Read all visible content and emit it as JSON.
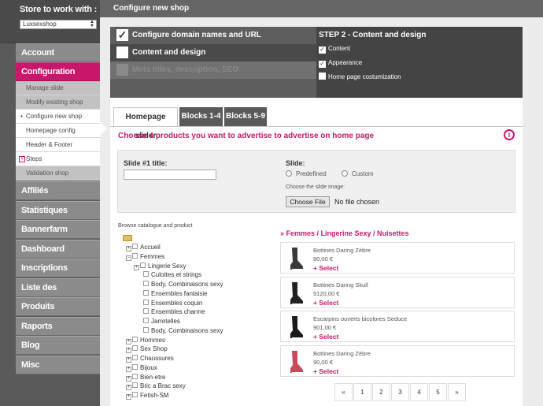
{
  "sidebar": {
    "title": "Store to work with :",
    "store_selected": "Luxsexshop",
    "nav_top": [
      {
        "label": "Account",
        "active": false
      },
      {
        "label": "Configuration boutique",
        "active": true
      }
    ],
    "sub_items": [
      {
        "label": "Manage slide",
        "marker": ""
      },
      {
        "label": "Modify existing shop",
        "marker": ""
      },
      {
        "label": "Configure new shop",
        "marker": "•"
      },
      {
        "label": "Homepage config",
        "marker": ""
      },
      {
        "label": "Header & Footer",
        "marker": ""
      },
      {
        "label": "Steps",
        "marker": "plus"
      },
      {
        "label": "Validation shop",
        "marker": ""
      }
    ],
    "nav_bottom": [
      "Affiliés",
      "Statistiques",
      "Bannerfarm",
      "Dashboard",
      "Inscriptions",
      "Liste des commandes",
      "Produits",
      "Raports",
      "Blog",
      "Misc"
    ]
  },
  "header": {
    "title": "Configure new shop"
  },
  "wizard": {
    "steps": [
      {
        "label": "Configure domain names and URL",
        "checked": true,
        "dim": false
      },
      {
        "label": "Content and design",
        "checked": false,
        "dim": false
      },
      {
        "label": "Meta titles, description, SEO",
        "checked": false,
        "dim": true
      }
    ],
    "detail_title": "STEP 2 - Content and design",
    "detail_items": [
      {
        "label": "Content",
        "checked": true
      },
      {
        "label": "Appearance",
        "checked": true
      },
      {
        "label": "Home page costumization",
        "checked": false
      }
    ]
  },
  "tabs": [
    "Homepage slider",
    "Blocks 1-4",
    "Blocks 5-9"
  ],
  "instruction": "Choose 4 products you want to advertise to advertise on home page",
  "slide_form": {
    "title_label": "Slide #1 title:",
    "title_value": "",
    "slide_label": "Slide:",
    "radio_predefined": "Predefined",
    "radio_custom": "Custom",
    "choose_image_label": "Choose the slide image:",
    "file_button": "Choose File",
    "file_status": "No file chosen"
  },
  "browse_label": "Browse catalogue and product",
  "tree": [
    {
      "label": "Accueil",
      "level": 1,
      "expander": "+"
    },
    {
      "label": "Femmes",
      "level": 1,
      "expander": "-"
    },
    {
      "label": "Lingerie Sexy",
      "level": 2,
      "expander": "+"
    },
    {
      "label": "Culottes et strings",
      "level": 3,
      "expander": ""
    },
    {
      "label": "Body, Combinaisons sexy",
      "level": 3,
      "expander": ""
    },
    {
      "label": "Ensembles fantaisie",
      "level": 3,
      "expander": ""
    },
    {
      "label": "Ensembles coquin",
      "level": 3,
      "expander": ""
    },
    {
      "label": "Ensembles charme",
      "level": 3,
      "expander": ""
    },
    {
      "label": "Jarretelles",
      "level": 3,
      "expander": ""
    },
    {
      "label": "Body, Combinaisons sexy",
      "level": 3,
      "expander": ""
    },
    {
      "label": "Hommes",
      "level": 1,
      "expander": "+"
    },
    {
      "label": "Sex Shop",
      "level": 1,
      "expander": "+"
    },
    {
      "label": "Chaussures",
      "level": 1,
      "expander": "+"
    },
    {
      "label": "Bijoux",
      "level": 1,
      "expander": "+"
    },
    {
      "label": "Bien-etre",
      "level": 1,
      "expander": "+"
    },
    {
      "label": "Bric a Brac sexy",
      "level": 1,
      "expander": "+"
    },
    {
      "label": "Fetish-SM",
      "level": 1,
      "expander": "+"
    }
  ],
  "breadcrumb": "» Femmes / Lingerine Sexy / Nuisettes",
  "products": [
    {
      "name": "Bottines Daring Zèbre",
      "price": "90,00 €",
      "select": "+ Select",
      "img_color": "#3a3a3a"
    },
    {
      "name": "Bottines Daring Skull",
      "price": "9120,00 €",
      "select": "+ Select",
      "img_color": "#222222"
    },
    {
      "name": "Escarpins ouverts bicolores Seduce",
      "price": "901,00 €",
      "select": "+ Select",
      "img_color": "#1a1a1a"
    },
    {
      "name": "Bottines Daring Zèbre",
      "price": "90,00 €",
      "select": "+ Select",
      "img_color": "#c94a5a"
    }
  ],
  "pager": [
    "«",
    "1",
    "2",
    "3",
    "4",
    "5",
    "»"
  ],
  "colors": {
    "accent": "#c9186c",
    "sidebar": "#5a5a5a",
    "nav_item": "#8b8b8b"
  }
}
